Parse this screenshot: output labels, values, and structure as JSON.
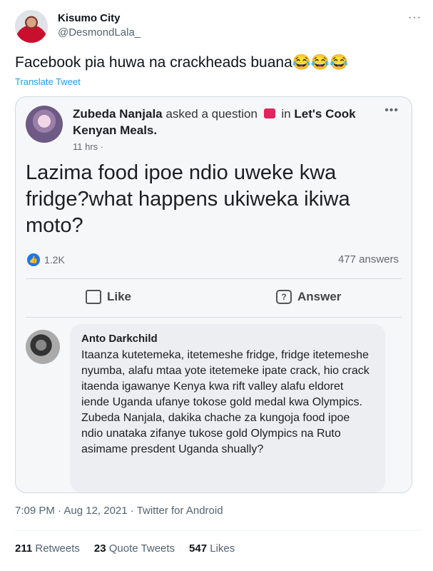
{
  "tweet": {
    "display_name": "Kisumo City",
    "handle": "@DesmondLala_",
    "more_icon": "more-icon",
    "text": "Facebook pia huwa na crackheads buana😂😂😂",
    "translate": "Translate Tweet",
    "timestamp": "7:09 PM · Aug 12, 2021 · Twitter for Android",
    "stats": {
      "retweets_count": "211",
      "retweets_label": "Retweets",
      "quotes_count": "23",
      "quotes_label": "Quote Tweets",
      "likes_count": "547",
      "likes_label": "Likes"
    }
  },
  "facebook_post": {
    "author": "Zubeda Nanjala",
    "action": "asked a question",
    "in_label": "in",
    "group": "Let's Cook Kenyan Meals.",
    "time": "11 hrs ·",
    "question": "Lazima food ipoe ndio uweke kwa fridge?what happens ukiweka ikiwa moto?",
    "reactions": "1.2K",
    "answers": "477 answers",
    "like_label": "Like",
    "answer_label": "Answer",
    "comment": {
      "name": "Anto Darkchild",
      "text": "Itaanza kutetemeka, itetemeshe fridge, fridge itetemeshe nyumba, alafu mtaa yote itetemeke ipate crack, hio crack itaenda igawanye Kenya kwa rift valley alafu eldoret iende Uganda ufanye tokose gold medal kwa Olympics. Zubeda Nanjala, dakika chache za kungoja food ipoe ndio unataka zifanye tukose gold Olympics na Ruto asimame presdent Uganda shually?"
    }
  }
}
